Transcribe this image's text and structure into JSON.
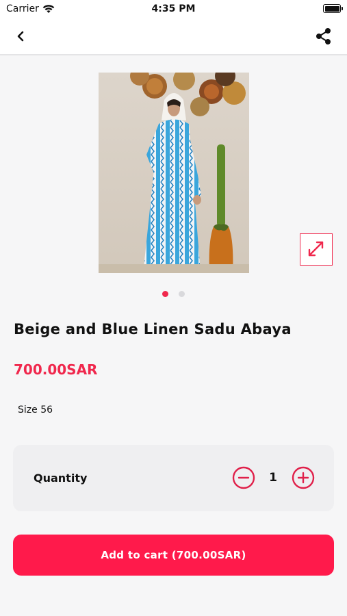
{
  "status_bar": {
    "carrier": "Carrier",
    "time": "4:35 PM"
  },
  "product": {
    "title": "Beige and Blue Linen Sadu Abaya",
    "price": "700.00SAR",
    "size": "Size 56",
    "image_count": 2,
    "active_image_index": 0
  },
  "quantity": {
    "label": "Quantity",
    "value": "1"
  },
  "cart": {
    "button_label": "Add to cart (700.00SAR)"
  },
  "colors": {
    "accent": "#f0284d",
    "button": "#ff1a4b",
    "background": "#f6f6f7"
  },
  "icons": {
    "back": "chevron-left-icon",
    "share": "share-icon",
    "expand": "expand-icon",
    "minus": "minus-circle-icon",
    "plus": "plus-circle-icon"
  }
}
